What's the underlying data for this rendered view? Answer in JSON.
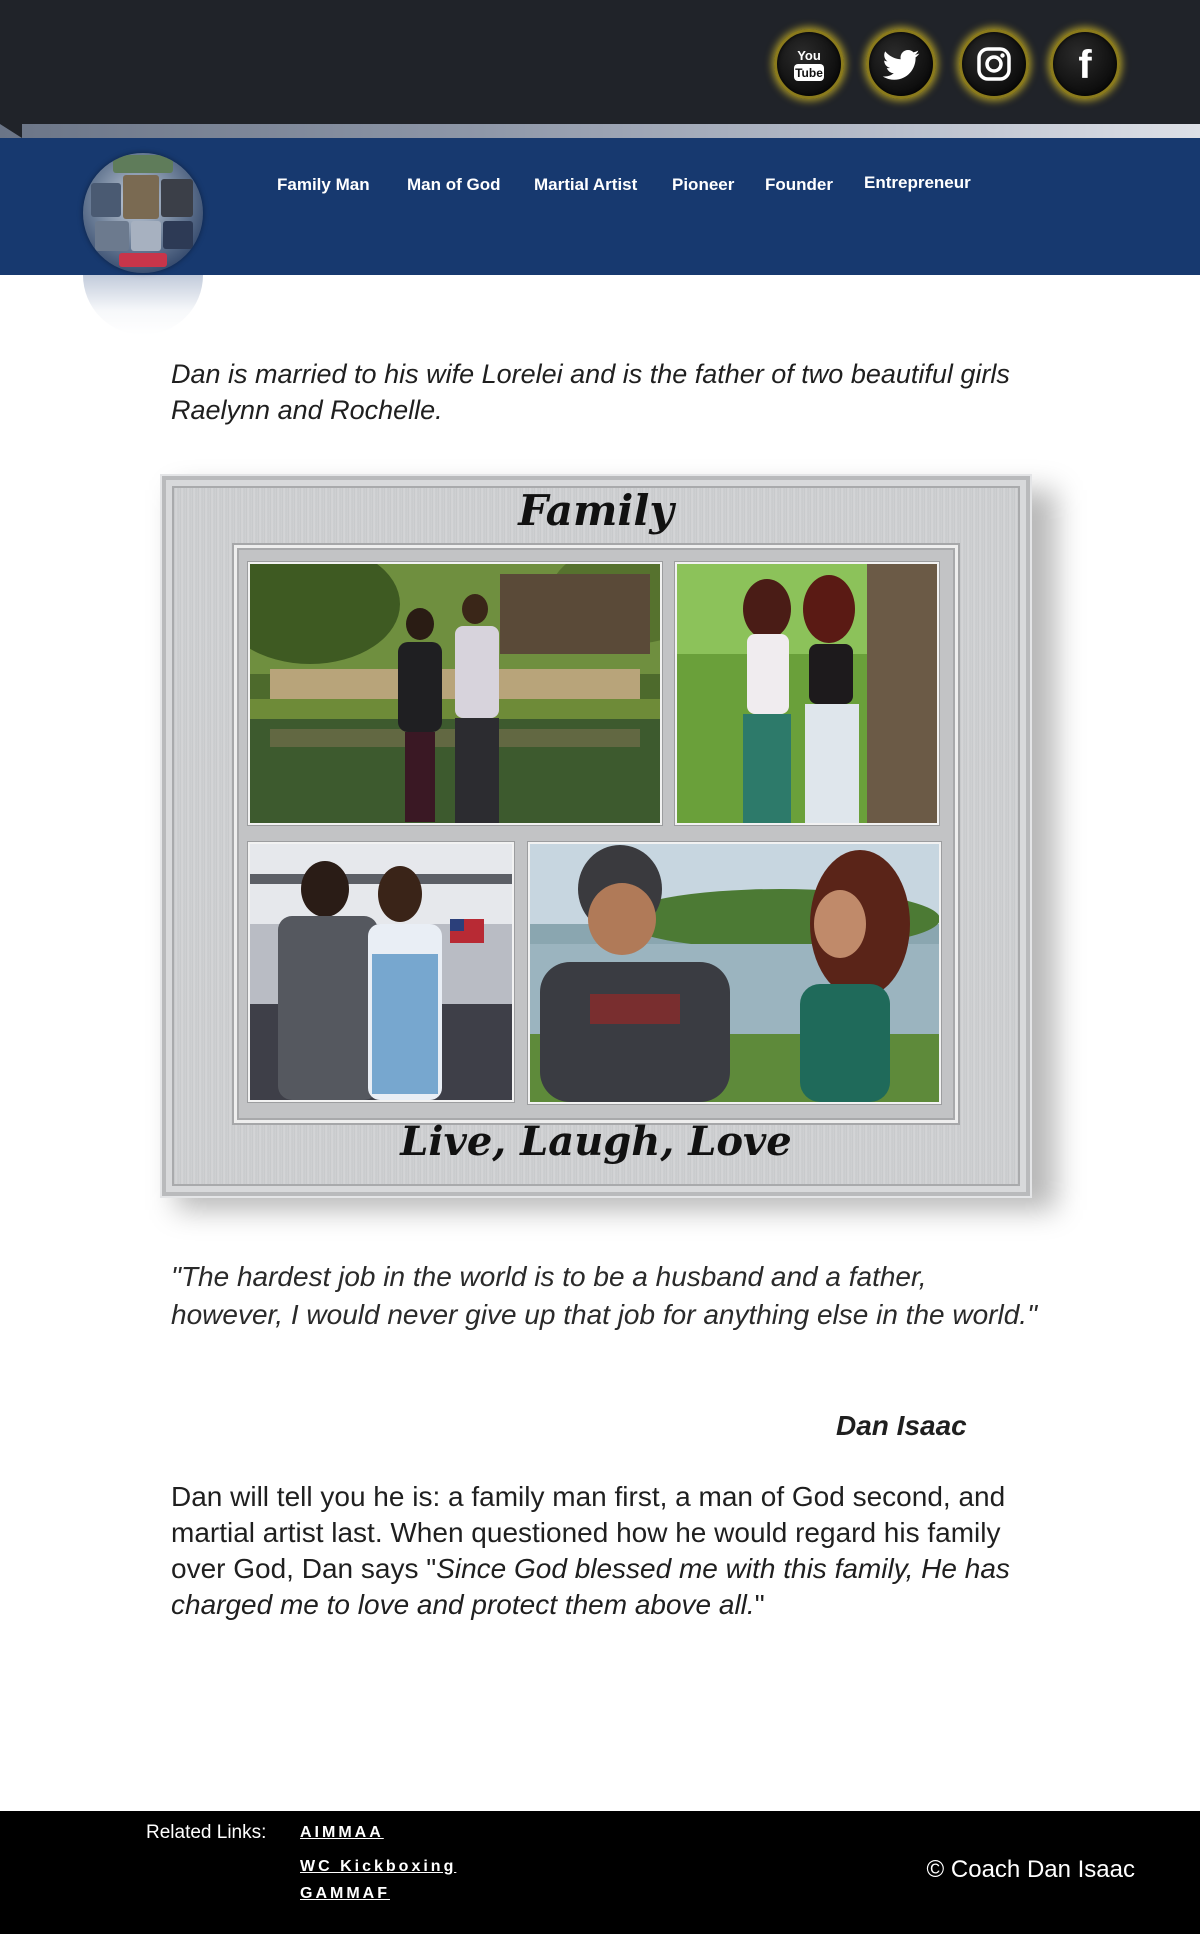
{
  "header": {
    "social": [
      {
        "icon": "youtube-icon",
        "label_top": "You",
        "label_bottom": "Tube"
      },
      {
        "icon": "twitter-icon"
      },
      {
        "icon": "instagram-icon"
      },
      {
        "icon": "facebook-icon",
        "glyph": "f"
      }
    ],
    "nav": [
      "Family Man",
      "Man of God",
      "Martial Artist",
      "Pioneer",
      "Founder",
      "Entrepreneur"
    ]
  },
  "main": {
    "intro": "Dan is married to his wife Lorelei and is the father of two beautiful girls Raelynn and Rochelle.",
    "frame_title": "Family",
    "frame_caption": "Live, Laugh, Love",
    "quote": "\"The hardest job in the world is to be a husband and a father, however, I would never give up that job for anything else in the world.\"",
    "author": "Dan Isaac",
    "closing_plain": "Dan will tell you he is: a family man first, a man of God second, and martial artist last. When questioned how he would regard his family over God, Dan says \"",
    "closing_italic": "Since God blessed me with this family, He has charged me to love and protect them above all.",
    "closing_end": "\""
  },
  "footer": {
    "related_label": "Related Links:",
    "links": [
      "AIMMAA",
      "WC Kickboxing",
      "GAMMAF"
    ],
    "copyright": "© Coach Dan Isaac"
  },
  "colors": {
    "topbar": "#202329",
    "navband": "#17396f",
    "footer": "#000000",
    "social_ring": "#d6be28"
  }
}
